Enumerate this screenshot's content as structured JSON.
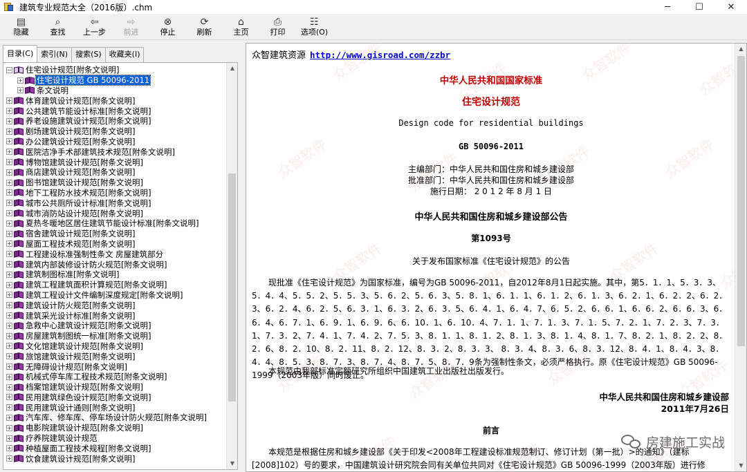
{
  "window": {
    "title": "建筑专业规范大全（2016版）.chm",
    "minimize": "─",
    "maximize": "☐",
    "close": "✕"
  },
  "toolbar": {
    "buttons": [
      {
        "label": "隐藏",
        "icon": "hide-icon",
        "glyph": "▤"
      },
      {
        "label": "查找",
        "icon": "find-icon",
        "glyph": "⌕"
      },
      {
        "label": "上一步",
        "icon": "back-icon",
        "glyph": "⇦"
      },
      {
        "label": "前进",
        "icon": "forward-icon",
        "glyph": "⇨",
        "disabled": true
      },
      {
        "label": "停止",
        "icon": "stop-icon",
        "glyph": "⊗"
      },
      {
        "label": "刷新",
        "icon": "refresh-icon",
        "glyph": "⟳"
      },
      {
        "label": "主页",
        "icon": "home-icon",
        "glyph": "⌂"
      },
      {
        "label": "打印",
        "icon": "print-icon",
        "glyph": "⎙"
      },
      {
        "label": "选项(O)",
        "icon": "options-icon",
        "glyph": "☷"
      }
    ]
  },
  "nav_tabs": [
    {
      "label": "目录(C)",
      "active": true
    },
    {
      "label": "索引(N)",
      "active": false
    },
    {
      "label": "搜索(S)",
      "active": false
    },
    {
      "label": "收藏夹(I)",
      "active": false
    }
  ],
  "tree": {
    "items": [
      {
        "label": "住宅设计规范[附条文说明]",
        "expanded": true,
        "level": 0
      },
      {
        "label": "住宅设计规范 GB 50096-2011",
        "level": 1,
        "selected": true
      },
      {
        "label": "条文说明",
        "level": 1
      },
      {
        "label": "体育建筑设计规范[附条文说明]",
        "level": 0
      },
      {
        "label": "公共建筑节能设计标准[附条文说明]",
        "level": 0
      },
      {
        "label": "养老设施建筑设计规范[附条文说明]",
        "level": 0
      },
      {
        "label": "剧场建筑设计规范[附条文说明]",
        "level": 0
      },
      {
        "label": "办公建筑设计规范[附条文说明]",
        "level": 0
      },
      {
        "label": "医院洁净手术部建筑技术规范[附条文说明]",
        "level": 0
      },
      {
        "label": "博物馆建筑设计规范[附条文说明]",
        "level": 0
      },
      {
        "label": "商店建筑设计规范[附条文说明]",
        "level": 0
      },
      {
        "label": "图书馆建筑设计规范[附条文说明]",
        "level": 0
      },
      {
        "label": "地下工程防水技术规范[附条文说明]",
        "level": 0
      },
      {
        "label": "城市公共厕所设计标准[附条文说明]",
        "level": 0
      },
      {
        "label": "城市消防站设计规范[附条文说明]",
        "level": 0
      },
      {
        "label": "夏热冬暖地区居住建筑节能设计标准[附条文说明]",
        "level": 0
      },
      {
        "label": "宿舍建筑设计规范[附条文说明]",
        "level": 0
      },
      {
        "label": "屋面工程技术规范[附条文说明]",
        "level": 0
      },
      {
        "label": "工程建设标准强制性条文 房屋建筑部分",
        "level": 0
      },
      {
        "label": "建筑内部装修设计防火规范[附条文说明]",
        "level": 0
      },
      {
        "label": "建筑制图标准[附条文说明]",
        "level": 0
      },
      {
        "label": "建筑工程建筑面积计算规范[附条文说明]",
        "level": 0
      },
      {
        "label": "建筑工程设计文件编制深度规定[附条文说明]",
        "level": 0
      },
      {
        "label": "建筑设计防火规范[附条文说明]",
        "level": 0
      },
      {
        "label": "建筑采光设计标准[附条文说明]",
        "level": 0
      },
      {
        "label": "急救中心建筑设计规范[附条文说明]",
        "level": 0
      },
      {
        "label": "房屋建筑制图统一标准[附条文说明]",
        "level": 0
      },
      {
        "label": "文化馆建筑设计规范[附条文说明]",
        "level": 0
      },
      {
        "label": "旅馆建筑设计规范[附条文说明]",
        "level": 0
      },
      {
        "label": "无障碍设计规范[附条文说明]",
        "level": 0
      },
      {
        "label": "机械式停车库工程技术规范[附条文说明]",
        "level": 0
      },
      {
        "label": "档案馆建筑设计规范[附条文说明]",
        "level": 0
      },
      {
        "label": "民用建筑绿色设计规范[附条文说明]",
        "level": 0
      },
      {
        "label": "民用建筑设计通则[附条文说明]",
        "level": 0
      },
      {
        "label": "汽车库、修车库、停车场设计防火规范[附条文说明]",
        "level": 0
      },
      {
        "label": "电影院建筑设计规范[附条文说明]",
        "level": 0
      },
      {
        "label": "疗养院建筑设计规范",
        "level": 0
      },
      {
        "label": "种植屋面工程技术规程[附条文说明]",
        "level": 0
      },
      {
        "label": "饮食建筑设计规范[附条文说明]",
        "level": 0
      }
    ]
  },
  "document": {
    "site_name": "众智建筑资源",
    "site_url": "http://www.gisroad.com/zzbr",
    "national_standard": "中华人民共和国国家标准",
    "title_cn": "住宅设计规范",
    "title_en": "Design code for residential buildings",
    "code": "GB 50096-2011",
    "editor": "主编部门：中华人民共和国住房和城乡建设部",
    "approver": "批准部门：中华人民共和国住房和城乡建设部",
    "effective": "施行日期： 2 0 1 2 年 8 月 1 日",
    "announcement_title": "中华人民共和国住房和城乡建设部公告",
    "announcement_no": "第1093号",
    "announcement_subject": "关于发布国家标准《住宅设计规范》的公告",
    "paragraph1": "现批准《住宅设计规范》为国家标准，编号为GB 50096-2011，自2012年8月1日起实施。其中，第5．1．1、5．3．3、5．4．4、5．5．2、5．5．3、5．6．2、5．6．3、5．8．1、6．1．1、6．1．2、6．1．3、6．2．1、6．2．2、6．2．3、6．2．4、6．2．5、6．3．1、6．3．2、6．3．5、6．4．1、6．4．7、6．5．2、6．6．1、6．6．2、6．6．3、6．6．4、6．7．1、6．9．1、6．9．6、6．10．1、6．10．4、7．1．1、7．1．3、7．1．5、7．2．1、7．2．3、7．3．1、7．3．2、7．4．1、7．4．2、7．5．3、8．1．1、8．1．2、8．1．3、8．1．4、8．1．7、8．2．1、8．2．2、8．2．6、8．2．10、8．2．11、8．2．12、8．3．2、8．3．3、 8．3．4、8．3．6、8．3．12、8．4．1、8．4．3、8．4．4、8．5．3、8．7．3、8．7．4、8．7．5、8．7．9条为强制性条文，必须严格执行。原《住宅设计规范》GB 50096-1999（2003年版）同时废止。",
    "paragraph2": "本规范由我部标准定额研究所组织中国建筑工业出版社出版发行。",
    "signature_org": "中华人民共和国住房和城乡建设部",
    "signature_date": "2011年7月26日",
    "foreword_title": "前言",
    "foreword_text": "本规范是根据住房和城乡建设部《关于印发<2008年工程建设标准规范制订、修订计划（第一批）>的通知》（建标[2008]102）号的要求，中国建筑设计研究院会同有关单位共同对《住宅设计规范》GB 50096-1999（2003年版）进行修",
    "watermark_text": "众智软件"
  },
  "overlay": {
    "wechat_label": "房建施工实战"
  }
}
